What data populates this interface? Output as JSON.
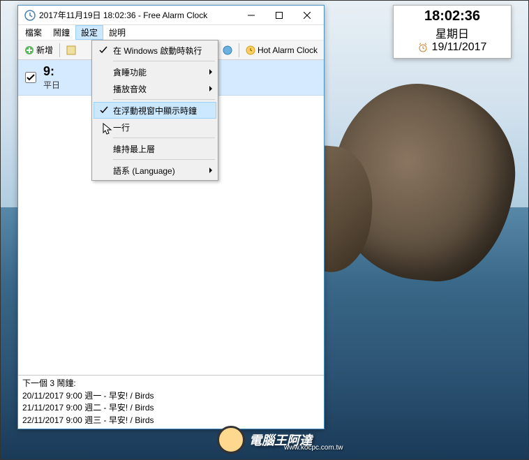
{
  "window": {
    "title": "2017年11月19日 18:02:36 - Free Alarm Clock"
  },
  "menubar": {
    "items": [
      "檔案",
      "鬧鐘",
      "設定",
      "說明"
    ],
    "open_index": 2
  },
  "toolbar": {
    "add": "新增",
    "hot": "Hot Alarm Clock"
  },
  "dropdown": {
    "items": [
      {
        "label": "在 Windows 啟動時執行",
        "checked": true,
        "submenu": false
      },
      {
        "sep": true
      },
      {
        "label": "貪睡功能",
        "submenu": true
      },
      {
        "label": "播放音效",
        "submenu": true
      },
      {
        "sep": true
      },
      {
        "label": "在浮動視窗中顯示時鐘",
        "checked": true,
        "hover": true
      },
      {
        "label": "一行"
      },
      {
        "sep": true
      },
      {
        "label": "維持最上層"
      },
      {
        "sep": true
      },
      {
        "label": "語系 (Language)",
        "submenu": true
      }
    ]
  },
  "alarm": {
    "time": "9:",
    "sub": "平日"
  },
  "status": {
    "header": "下一個 3 鬧鐘:",
    "lines": [
      "20/11/2017 9:00 週一 - 早安! / Birds",
      "21/11/2017 9:00 週二 - 早安! / Birds",
      "22/11/2017 9:00 週三 - 早安! / Birds"
    ]
  },
  "float_clock": {
    "time": "18:02:36",
    "day": "星期日",
    "date": "19/11/2017"
  },
  "watermark": {
    "text": "電腦王阿達",
    "url": "www.kocpc.com.tw"
  }
}
